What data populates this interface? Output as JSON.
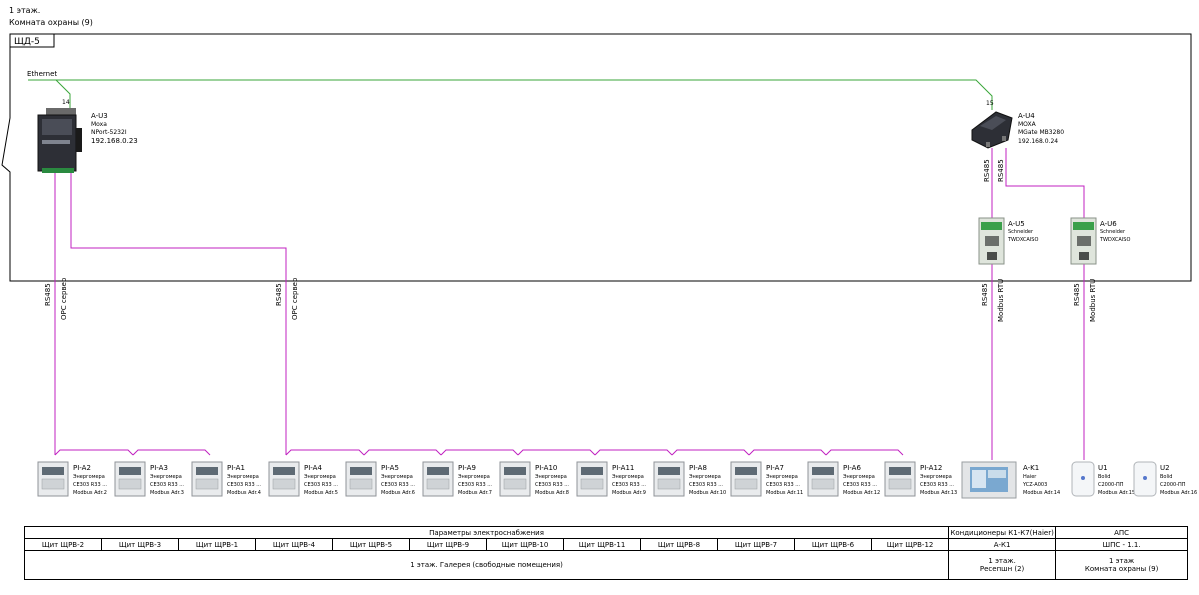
{
  "header": {
    "floor": "1 этаж.",
    "room": "Комната охраны (9)"
  },
  "panel": {
    "label": "ЩД-5",
    "network": "Ethernet"
  },
  "colors": {
    "ethernet": "#3aa63a",
    "rs485": "#c020c0",
    "frame": "#000000"
  },
  "gateways": [
    {
      "port": "14",
      "id": "A-U3",
      "make": "Moxa",
      "model": "NPort-5232I",
      "ip": "192.168.0.23"
    },
    {
      "port": "15",
      "id": "A-U4",
      "make": "MOXA",
      "model": "MGate MB3280",
      "ip": "192.168.0.24"
    }
  ],
  "converters": [
    {
      "id": "A-U5",
      "make": "Schneider",
      "model": "TWDXCAISO"
    },
    {
      "id": "A-U6",
      "make": "Schneider",
      "model": "TWDXCAISO"
    }
  ],
  "bus_labels": {
    "rs485": "RS485",
    "opc": "OPC сервер",
    "modbus": "Modbus RTU"
  },
  "meters": [
    {
      "id": "PI-A2",
      "l1": "Энергомера",
      "l2": "CE303 R33 ...",
      "addr": "Modbus Adr.2"
    },
    {
      "id": "PI-A3",
      "l1": "Энергомера",
      "l2": "CE303 R33 ...",
      "addr": "Modbus Adr.3"
    },
    {
      "id": "PI-A1",
      "l1": "Энергомера",
      "l2": "CE303 R33 ...",
      "addr": "Modbus Adr.4"
    },
    {
      "id": "PI-A4",
      "l1": "Энергомера",
      "l2": "CE303 R33 ...",
      "addr": "Modbus Adr.5"
    },
    {
      "id": "PI-A5",
      "l1": "Энергомера",
      "l2": "CE303 R33 ...",
      "addr": "Modbus Adr.6"
    },
    {
      "id": "PI-A9",
      "l1": "Энергомера",
      "l2": "CE303 R33 ...",
      "addr": "Modbus Adr.7"
    },
    {
      "id": "PI-A10",
      "l1": "Энергомера",
      "l2": "CE303 R33 ...",
      "addr": "Modbus Adr.8"
    },
    {
      "id": "PI-A11",
      "l1": "Энергомера",
      "l2": "CE303 R33 ...",
      "addr": "Modbus Adr.9"
    },
    {
      "id": "PI-A8",
      "l1": "Энергомера",
      "l2": "CE303 R33 ...",
      "addr": "Modbus Adr.10"
    },
    {
      "id": "PI-A7",
      "l1": "Энергомера",
      "l2": "CE303 R33 ...",
      "addr": "Modbus Adr.11"
    },
    {
      "id": "PI-A6",
      "l1": "Энергомера",
      "l2": "CE303 R33 ...",
      "addr": "Modbus Adr.12"
    },
    {
      "id": "PI-A12",
      "l1": "Энергомера",
      "l2": "CE303 R33 ...",
      "addr": "Modbus Adr.13"
    }
  ],
  "hvac": {
    "id": "A-K1",
    "l1": "Haier",
    "l2": "YCZ-A003",
    "addr": "Modbus Adr.14"
  },
  "fire": [
    {
      "id": "U1",
      "l1": "Bolid",
      "l2": "C2000-ПП",
      "addr": "Modbus Adr.15"
    },
    {
      "id": "U2",
      "l1": "Bolid",
      "l2": "C2000-ПП",
      "addr": "Modbus Adr.16"
    }
  ],
  "legend": {
    "group1_title": "Параметры электроснабжения",
    "group2_title": "Кондиционеры К1-К7(Haier)",
    "group3_title": "АПС",
    "panels": [
      "Щит ЩРВ-2",
      "Щит ЩРВ-3",
      "Щит ЩРВ-1",
      "Щит ЩРВ-4",
      "Щит ЩРВ-5",
      "Щит ЩРВ-9",
      "Щит ЩРВ-10",
      "Щит ЩРВ-11",
      "Щит ЩРВ-8",
      "Щит ЩРВ-7",
      "Щит ЩРВ-6",
      "Щит ЩРВ-12"
    ],
    "hvac_panel": "А-К1",
    "fire_panel": "ШПС - 1.1.",
    "loc1": "1 этаж. Галерея (свободные помещения)",
    "loc2_a": "1 этаж.",
    "loc2_b": "Ресепшн (2)",
    "loc3_a": "1 этаж",
    "loc3_b": "Комната охраны (9)"
  }
}
